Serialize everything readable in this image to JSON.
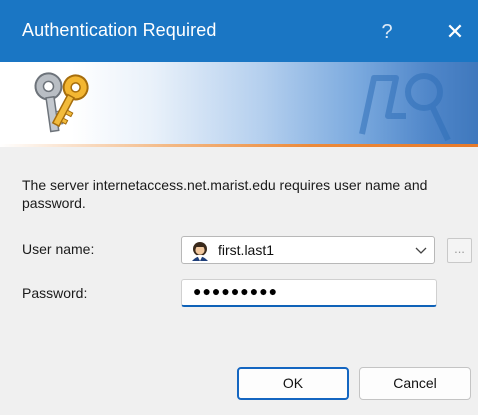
{
  "window": {
    "title": "Authentication Required",
    "help_label": "?",
    "close_label": "✕"
  },
  "banner": {
    "icon": "keys-icon",
    "watermark": "keys-watermark-icon"
  },
  "message": "The server internetaccess.net.marist.edu requires user name and password.",
  "form": {
    "username_label": "User name:",
    "username_value": "first.last1",
    "username_icon": "user-icon",
    "browse_label": "...",
    "password_label": "Password:",
    "password_value": "●●●●●●●●●"
  },
  "buttons": {
    "ok": "OK",
    "cancel": "Cancel"
  },
  "colors": {
    "titlebar": "#1a76c4",
    "accent": "#1466c1",
    "banner_line": "#e77a2a"
  }
}
